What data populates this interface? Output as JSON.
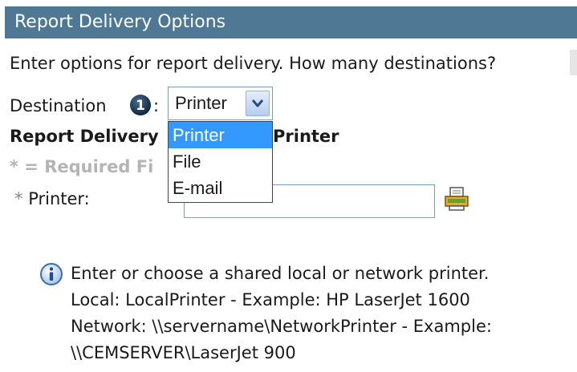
{
  "header": {
    "title": "Report Delivery Options"
  },
  "intro": {
    "text": "Enter options for report delivery. How many destinations?"
  },
  "destination": {
    "label": "Destination",
    "step_number": "1",
    "colon": ":",
    "selected": "Printer",
    "options": [
      "Printer",
      "File",
      "E-mail"
    ]
  },
  "section": {
    "heading": "Report Delivery",
    "heading_suffix": "Printer"
  },
  "required_note": {
    "text": "* = Required Fi"
  },
  "printer_field": {
    "star": "*",
    "label": "Printer:",
    "value": ""
  },
  "help": {
    "lines": [
      "Enter or choose a shared local or network printer.",
      "Local: LocalPrinter - Example: HP LaserJet 1600",
      "Network: \\\\servername\\NetworkPrinter - Example:",
      "\\\\CEMSERVER\\LaserJet 900"
    ]
  },
  "colors": {
    "header_bg": "#4f7895",
    "selection": "#3399ff",
    "required_gray": "#b4b4b4",
    "input_border": "#7f9db9"
  },
  "icons": {
    "step": "step-number-badge-icon",
    "dropdown": "chevron-down-icon",
    "printer": "printer-icon",
    "info": "info-icon"
  }
}
